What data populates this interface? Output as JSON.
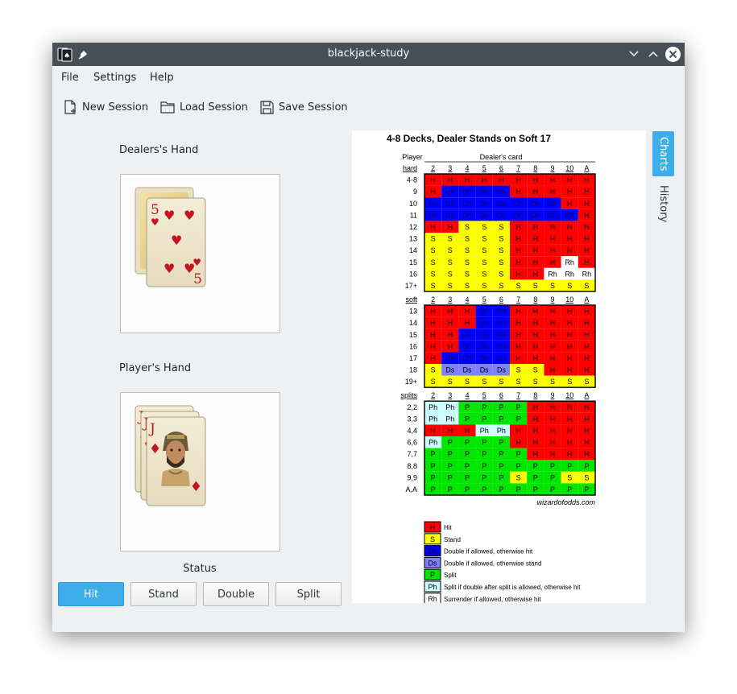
{
  "window": {
    "title": "blackjack-study"
  },
  "menu": [
    "File",
    "Settings",
    "Help"
  ],
  "toolbar": {
    "new": "New Session",
    "load": "Load Session",
    "save": "Save Session"
  },
  "dealer_label": "Dealers's Hand",
  "player_label": "Player's Hand",
  "status_label": "Status",
  "buttons": {
    "hit": "Hit",
    "stand": "Stand",
    "double": "Double",
    "split": "Split"
  },
  "tabs": {
    "charts": "Charts",
    "history": "History"
  },
  "dealer_cards": [
    {
      "rank": "5",
      "suit": "♥"
    }
  ],
  "player_cards": [
    {
      "rank": "J",
      "suit": "♦"
    }
  ],
  "chart": {
    "title": "4-8 Decks, Dealer Stands on Soft 17",
    "player_label": "Player",
    "dealer_label": "Dealer's card",
    "cols": [
      "2",
      "3",
      "4",
      "5",
      "6",
      "7",
      "8",
      "9",
      "10",
      "A"
    ],
    "sections": [
      {
        "name": "hard",
        "rows": [
          [
            "4-8",
            "H H H H H H H H H H"
          ],
          [
            "9",
            "H Dh Dh Dh Dh H H H H H"
          ],
          [
            "10",
            "Dh Dh Dh Dh Dh Dh Dh Dh H H"
          ],
          [
            "11",
            "Dh Dh Dh Dh Dh Dh Dh Dh Dh H"
          ],
          [
            "12",
            "H H S S S H H H H H"
          ],
          [
            "13",
            "S S S S S H H H H H"
          ],
          [
            "14",
            "S S S S S H H H H H"
          ],
          [
            "15",
            "S S S S S H H H Rh H"
          ],
          [
            "16",
            "S S S S S H H Rh Rh Rh"
          ],
          [
            "17+",
            "S S S S S S S S S S"
          ]
        ]
      },
      {
        "name": "soft",
        "rows": [
          [
            "13",
            "H H H Dh Dh H H H H H"
          ],
          [
            "14",
            "H H H Dh Dh H H H H H"
          ],
          [
            "15",
            "H H Dh Dh Dh H H H H H"
          ],
          [
            "16",
            "H H Dh Dh Dh H H H H H"
          ],
          [
            "17",
            "H Dh Dh Dh Dh H H H H H"
          ],
          [
            "18",
            "S Ds Ds Ds Ds S S H H H"
          ],
          [
            "19+",
            "S S S S S S S S S S"
          ]
        ]
      },
      {
        "name": "splits",
        "rows": [
          [
            "2,2",
            "Ph Ph P P P P H H H H"
          ],
          [
            "3,3",
            "Ph Ph P P P P H H H H"
          ],
          [
            "4,4",
            "H H H Ph Ph H H H H H"
          ],
          [
            "6,6",
            "Ph P P P P H H H H H"
          ],
          [
            "7,7",
            "P P P P P P H H H H"
          ],
          [
            "8,8",
            "P P P P P P P P P P"
          ],
          [
            "9,9",
            "P P P P P S P P S S"
          ],
          [
            "A,A",
            "P P P P P P P P P P"
          ]
        ]
      }
    ],
    "source": "wizardofodds.com",
    "legend": [
      [
        "H",
        "Hit"
      ],
      [
        "S",
        "Stand"
      ],
      [
        "Dh",
        "Double if allowed, otherwise hit"
      ],
      [
        "Ds",
        "Double if allowed, otherwise stand"
      ],
      [
        "P",
        "Split"
      ],
      [
        "Ph",
        "Split if double after split is allowed, otherwise hit"
      ],
      [
        "Rh",
        "Surrender if allowed, otherwise hit"
      ]
    ],
    "colors": {
      "H": "#ff0000",
      "S": "#ffff00",
      "Dh": "#0000ff",
      "Ds": "#7f7fff",
      "P": "#00e600",
      "Ph": "#ccffff",
      "Rh": "#ffffff"
    }
  }
}
